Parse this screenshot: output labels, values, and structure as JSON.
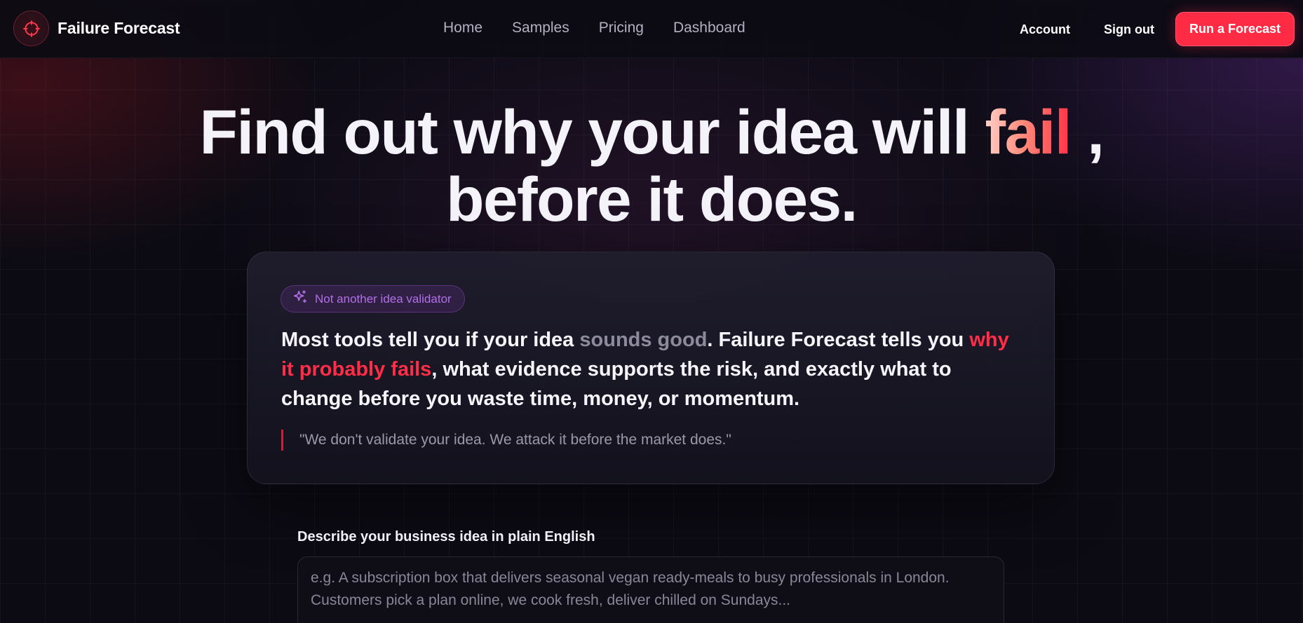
{
  "brand": {
    "name": "Failure Forecast",
    "logo_icon": "crosshair-icon",
    "accent": "#ff2a43"
  },
  "nav": {
    "links": [
      "Home",
      "Samples",
      "Pricing",
      "Dashboard"
    ],
    "account": "Account",
    "sign_out": "Sign out",
    "cta": "Run a Forecast"
  },
  "hero": {
    "line1_prefix": "Find out why your idea will",
    "highlight": "fail",
    "line1_suffix": ",",
    "line2": "before it does."
  },
  "card": {
    "badge": "Not another idea validator",
    "badge_icon": "sparkles-icon",
    "lead": {
      "part1": "Most tools tell you if your idea",
      "muted": "sounds good",
      "part2": ". Failure Forecast tells you",
      "red": "why it probably fails",
      "part3": ", what evidence supports the risk, and exactly what to change before you waste time, money, or momentum."
    },
    "quote": "\"We don't validate your idea. We attack it before the market does.\""
  },
  "form": {
    "label": "Describe your business idea in plain English",
    "value": "",
    "placeholder": "e.g. A subscription box that delivers seasonal vegan ready-meals to busy professionals in London. Customers pick a plan online, we cook fresh, deliver chilled on Sundays..."
  }
}
